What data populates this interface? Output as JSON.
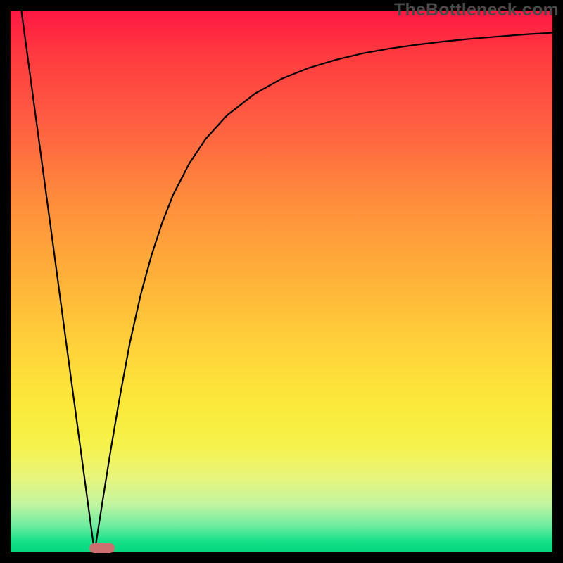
{
  "watermark": "TheBottleneck.com",
  "colors": {
    "frame": "#000000",
    "curve": "#000000",
    "marker": "#cd6f6f"
  },
  "chart_data": {
    "type": "line",
    "title": "",
    "xlabel": "",
    "ylabel": "",
    "xlim": [
      0,
      100
    ],
    "ylim": [
      0,
      100
    ],
    "curve": {
      "x": [
        2,
        4,
        6,
        8,
        10,
        12,
        14,
        15.5,
        17,
        18.5,
        20,
        22,
        24,
        26,
        28,
        30,
        33,
        36,
        40,
        45,
        50,
        55,
        60,
        65,
        70,
        75,
        80,
        85,
        90,
        95,
        100
      ],
      "y": [
        100,
        85.2,
        70.4,
        55.6,
        40.7,
        25.9,
        11.1,
        0,
        9.6,
        19.0,
        27.8,
        38.6,
        47.5,
        54.8,
        60.9,
        66.0,
        71.8,
        76.3,
        80.7,
        84.6,
        87.4,
        89.4,
        90.9,
        92.1,
        93.0,
        93.7,
        94.3,
        94.8,
        95.2,
        95.6,
        95.9
      ]
    },
    "marker": {
      "x_start": 14.6,
      "x_end": 19.2,
      "y": 0
    },
    "notes": "V-shaped curve: steep linear descent from top-left to minimum near x≈15.5, then asymptotic rise toward ~96% at right edge. Background is a vertical heat gradient (red→green). Axes unlabeled; values are percent of plot span."
  }
}
